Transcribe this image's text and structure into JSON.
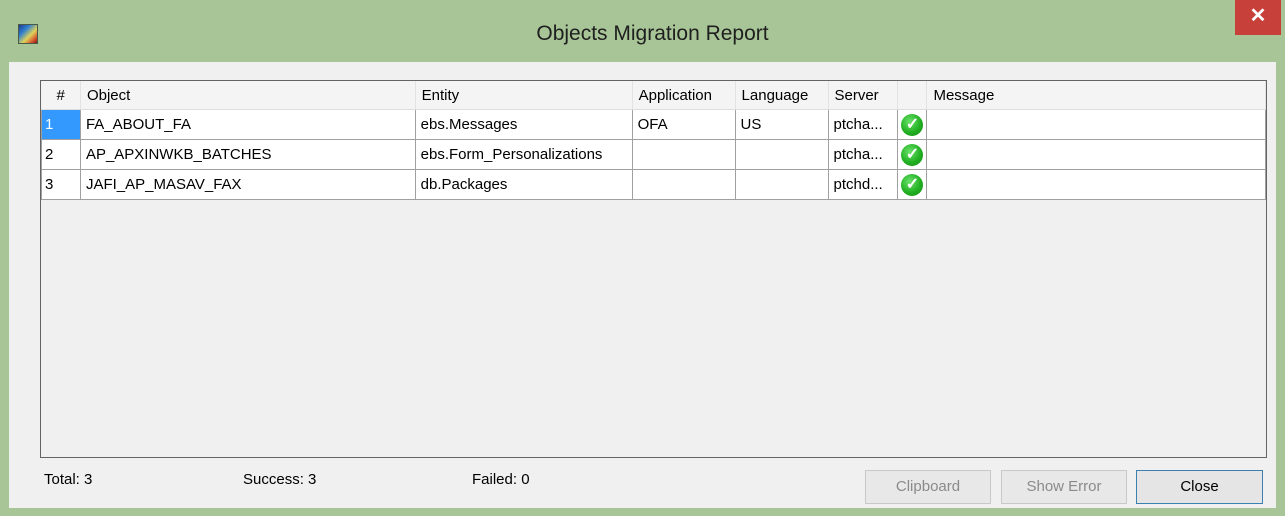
{
  "window": {
    "title": "Objects Migration Report",
    "close_glyph": "✕"
  },
  "table": {
    "columns": [
      "#",
      "Object",
      "Entity",
      "Application",
      "Language",
      "Server",
      "",
      "Message"
    ],
    "rows": [
      {
        "num": "1",
        "object": "FA_ABOUT_FA",
        "entity": "ebs.Messages",
        "application": "OFA",
        "language": "US",
        "server": "ptcha...",
        "status": "success-icon",
        "message": ""
      },
      {
        "num": "2",
        "object": "AP_APXINWKB_BATCHES",
        "entity": "ebs.Form_Personalizations",
        "application": "",
        "language": "",
        "server": "ptcha...",
        "status": "success-icon",
        "message": ""
      },
      {
        "num": "3",
        "object": "JAFI_AP_MASAV_FAX",
        "entity": "db.Packages",
        "application": "",
        "language": "",
        "server": "ptchd...",
        "status": "success-icon",
        "message": ""
      }
    ]
  },
  "footer": {
    "total": "Total: 3",
    "success": "Success: 3",
    "failed": "Failed: 0",
    "clipboard_label": "Clipboard",
    "show_error_label": "Show Error",
    "close_label": "Close"
  },
  "colors": {
    "title_bar": "#a8c597",
    "close_button": "#c7413a",
    "selection": "#3399ff",
    "success": "#22b022"
  }
}
